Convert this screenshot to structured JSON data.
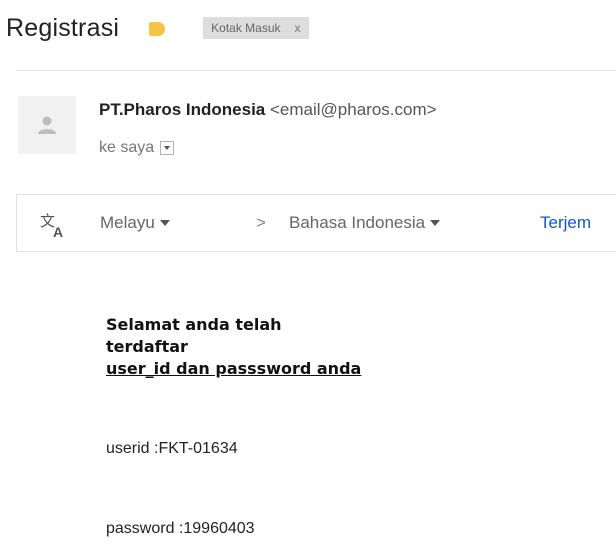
{
  "email": {
    "subject": "Registrasi",
    "label": "Kotak Masuk",
    "label_close": "x",
    "sender_name": "PT.Pharos Indonesia",
    "sender_email": "<email@pharos.com>",
    "recipient": "ke saya"
  },
  "translate_bar": {
    "source_language": "Melayu",
    "arrow": ">",
    "target_language": "Bahasa Indonesia",
    "translate_link": "Terjem"
  },
  "body": {
    "line1": "Selamat anda telah",
    "line2": "terdaftar",
    "line3": "user_id dan passsword anda",
    "userid": "userid :FKT-01634",
    "password": "password :19960403"
  },
  "colors": {
    "label_icon": "#f6c445",
    "link": "#1155cc"
  },
  "icons": [
    "label-tag-icon",
    "avatar-person-icon",
    "dropdown-icon",
    "translate-icon",
    "chevron-right-icon"
  ]
}
